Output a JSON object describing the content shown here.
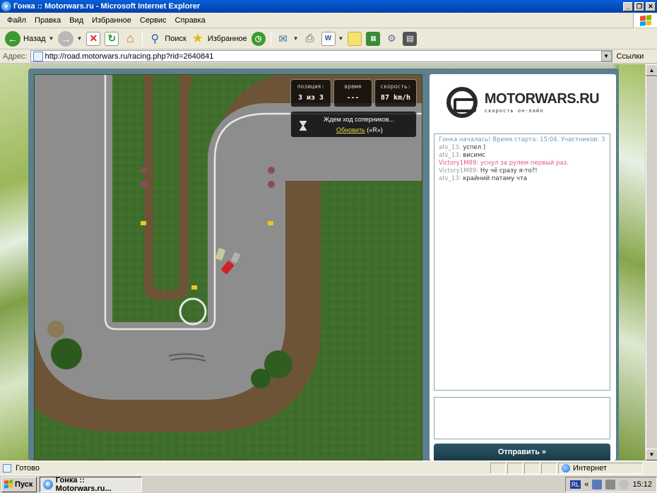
{
  "window": {
    "title": "Гонка :: Motorwars.ru - Microsoft Internet Explorer",
    "controls": [
      "_",
      "❐",
      "✕"
    ]
  },
  "menu": [
    "Файл",
    "Правка",
    "Вид",
    "Избранное",
    "Сервис",
    "Справка"
  ],
  "toolbar": {
    "back_label": "Назад",
    "search_label": "Поиск",
    "favorites_label": "Избранное"
  },
  "address": {
    "label": "Адрес:",
    "url": "http://road.motorwars.ru/racing.php?rid=2640841",
    "links_label": "Ссылки"
  },
  "hud": {
    "position": {
      "label": "позиция:",
      "value": "3 из 3"
    },
    "time": {
      "label": "время",
      "value": "---"
    },
    "speed": {
      "label": "скорость:",
      "value": "87 km/h"
    }
  },
  "wait": {
    "text": "Ждем ход соперников...",
    "refresh_link": "Обновить",
    "hotkey": "(«R»)"
  },
  "logo": {
    "name": "MOTORWARS.RU",
    "tagline": "скорость он-лайн"
  },
  "chat": {
    "messages": [
      {
        "kind": "sys",
        "nick": "",
        "text": "Гонка началась! Время старта: 15:04. Участников: 3"
      },
      {
        "kind": "n1",
        "nick": "atv_13:",
        "text": "успел )"
      },
      {
        "kind": "n1",
        "nick": "atv_13:",
        "text": "висимс"
      },
      {
        "kind": "n2",
        "nick": "Victory1M89:",
        "text": "уснул за рулем первый раз."
      },
      {
        "kind": "n1",
        "nick": "Victory1M89:",
        "text": "Ну чё сразу я-то?!"
      },
      {
        "kind": "n1",
        "nick": "atv_13:",
        "text": "крайний патаму чта"
      }
    ],
    "send_label": "Отправить »"
  },
  "status": {
    "text": "Готово",
    "zone": "Интернет"
  },
  "taskbar": {
    "start_label": "Пуск",
    "task_label": "Гонка :: Motorwars.ru...",
    "language": "RL",
    "clock": "15:12"
  },
  "colors": {
    "title_bar": "#0453c8",
    "panel_frame": "#5b7f8d",
    "send_button": "#183a48",
    "system_message": "#6a9bbd",
    "highlight_message": "#e05a78",
    "refresh_link": "#e8d44a"
  }
}
